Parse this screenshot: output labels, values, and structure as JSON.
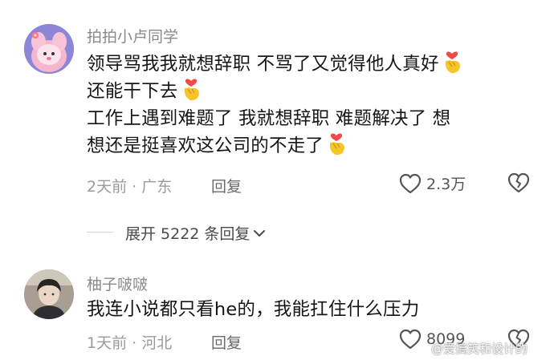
{
  "comment1": {
    "username": "拍拍小卢同学",
    "lines": [
      "领导骂我我就想辞职 不骂了又觉得他人真好",
      "还能干下去",
      "工作上遇到难题了 我就想辞职  难题解决了 想",
      "想还是挺喜欢这公司的不走了"
    ],
    "meta": "2天前 · 广东",
    "reply_label": "回复",
    "likes": "2.3万",
    "emoji_icon": "finger-heart-emoji"
  },
  "expand": {
    "label": "展开 5222 条回复"
  },
  "comment2": {
    "username": "柚子啵啵",
    "text": "我连小说都只看he的，我能扛住什么压力",
    "meta": "1天前 · 河北",
    "reply_label": "回复",
    "likes": "8099"
  },
  "watermark": "@爱搞笑和设计的",
  "colors": {
    "text": "#161616",
    "muted": "#8a8a8a",
    "emoji_yellow": "#f6c52a",
    "emoji_heart": "#f04a4a"
  }
}
